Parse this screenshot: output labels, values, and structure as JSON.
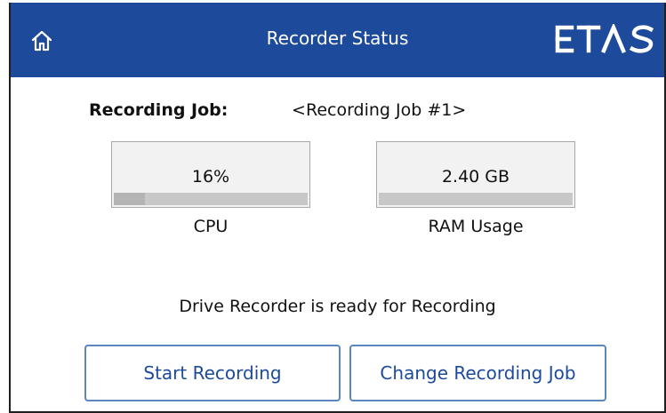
{
  "header": {
    "title": "Recorder Status",
    "home_icon": "home-icon",
    "logo_text": "ETAS",
    "background": "#1d4a9a"
  },
  "job": {
    "label": "Recording Job:",
    "value": "<Recording Job #1>"
  },
  "metrics": {
    "cpu": {
      "value": "16%",
      "caption": "CPU",
      "level_percent": 16
    },
    "ram": {
      "value": "2.40 GB",
      "caption": "RAM Usage"
    }
  },
  "status": {
    "message": "Drive Recorder is ready for Recording"
  },
  "buttons": {
    "start": "Start Recording",
    "change": "Change Recording Job",
    "text_color": "#1d4a9a",
    "border_color": "#5b86c2"
  }
}
